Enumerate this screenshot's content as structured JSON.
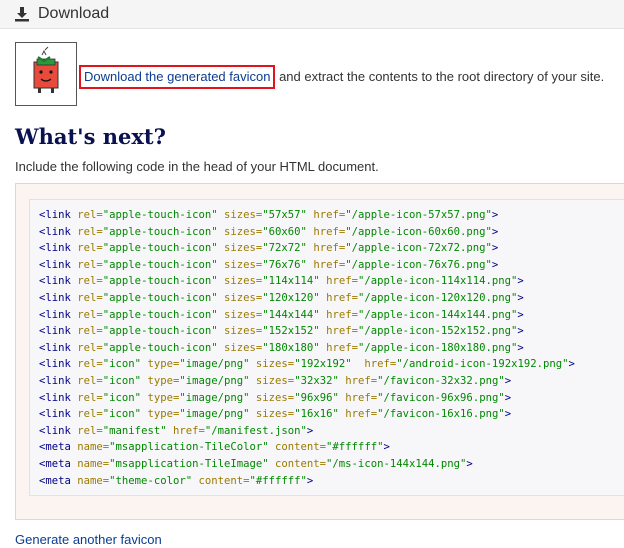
{
  "header": {
    "title": "Download",
    "icon": "download-icon"
  },
  "download": {
    "link_text": "Download the generated favicon",
    "rest_text": " and extract the contents to the root directory of your site."
  },
  "whats_next": {
    "title": "What's next?",
    "include_text": "Include the following code in the head of your HTML document."
  },
  "code_lines": [
    [
      [
        "tag",
        "<link"
      ],
      [
        "p",
        " "
      ],
      [
        "attr",
        "rel="
      ],
      [
        "val",
        "\"apple-touch-icon\""
      ],
      [
        "p",
        " "
      ],
      [
        "attr",
        "sizes="
      ],
      [
        "val",
        "\"57x57\""
      ],
      [
        "p",
        " "
      ],
      [
        "attr",
        "href="
      ],
      [
        "val",
        "\"/apple-icon-57x57.png\""
      ],
      [
        "tag",
        ">"
      ]
    ],
    [
      [
        "tag",
        "<link"
      ],
      [
        "p",
        " "
      ],
      [
        "attr",
        "rel="
      ],
      [
        "val",
        "\"apple-touch-icon\""
      ],
      [
        "p",
        " "
      ],
      [
        "attr",
        "sizes="
      ],
      [
        "val",
        "\"60x60\""
      ],
      [
        "p",
        " "
      ],
      [
        "attr",
        "href="
      ],
      [
        "val",
        "\"/apple-icon-60x60.png\""
      ],
      [
        "tag",
        ">"
      ]
    ],
    [
      [
        "tag",
        "<link"
      ],
      [
        "p",
        " "
      ],
      [
        "attr",
        "rel="
      ],
      [
        "val",
        "\"apple-touch-icon\""
      ],
      [
        "p",
        " "
      ],
      [
        "attr",
        "sizes="
      ],
      [
        "val",
        "\"72x72\""
      ],
      [
        "p",
        " "
      ],
      [
        "attr",
        "href="
      ],
      [
        "val",
        "\"/apple-icon-72x72.png\""
      ],
      [
        "tag",
        ">"
      ]
    ],
    [
      [
        "tag",
        "<link"
      ],
      [
        "p",
        " "
      ],
      [
        "attr",
        "rel="
      ],
      [
        "val",
        "\"apple-touch-icon\""
      ],
      [
        "p",
        " "
      ],
      [
        "attr",
        "sizes="
      ],
      [
        "val",
        "\"76x76\""
      ],
      [
        "p",
        " "
      ],
      [
        "attr",
        "href="
      ],
      [
        "val",
        "\"/apple-icon-76x76.png\""
      ],
      [
        "tag",
        ">"
      ]
    ],
    [
      [
        "tag",
        "<link"
      ],
      [
        "p",
        " "
      ],
      [
        "attr",
        "rel="
      ],
      [
        "val",
        "\"apple-touch-icon\""
      ],
      [
        "p",
        " "
      ],
      [
        "attr",
        "sizes="
      ],
      [
        "val",
        "\"114x114\""
      ],
      [
        "p",
        " "
      ],
      [
        "attr",
        "href="
      ],
      [
        "val",
        "\"/apple-icon-114x114.png\""
      ],
      [
        "tag",
        ">"
      ]
    ],
    [
      [
        "tag",
        "<link"
      ],
      [
        "p",
        " "
      ],
      [
        "attr",
        "rel="
      ],
      [
        "val",
        "\"apple-touch-icon\""
      ],
      [
        "p",
        " "
      ],
      [
        "attr",
        "sizes="
      ],
      [
        "val",
        "\"120x120\""
      ],
      [
        "p",
        " "
      ],
      [
        "attr",
        "href="
      ],
      [
        "val",
        "\"/apple-icon-120x120.png\""
      ],
      [
        "tag",
        ">"
      ]
    ],
    [
      [
        "tag",
        "<link"
      ],
      [
        "p",
        " "
      ],
      [
        "attr",
        "rel="
      ],
      [
        "val",
        "\"apple-touch-icon\""
      ],
      [
        "p",
        " "
      ],
      [
        "attr",
        "sizes="
      ],
      [
        "val",
        "\"144x144\""
      ],
      [
        "p",
        " "
      ],
      [
        "attr",
        "href="
      ],
      [
        "val",
        "\"/apple-icon-144x144.png\""
      ],
      [
        "tag",
        ">"
      ]
    ],
    [
      [
        "tag",
        "<link"
      ],
      [
        "p",
        " "
      ],
      [
        "attr",
        "rel="
      ],
      [
        "val",
        "\"apple-touch-icon\""
      ],
      [
        "p",
        " "
      ],
      [
        "attr",
        "sizes="
      ],
      [
        "val",
        "\"152x152\""
      ],
      [
        "p",
        " "
      ],
      [
        "attr",
        "href="
      ],
      [
        "val",
        "\"/apple-icon-152x152.png\""
      ],
      [
        "tag",
        ">"
      ]
    ],
    [
      [
        "tag",
        "<link"
      ],
      [
        "p",
        " "
      ],
      [
        "attr",
        "rel="
      ],
      [
        "val",
        "\"apple-touch-icon\""
      ],
      [
        "p",
        " "
      ],
      [
        "attr",
        "sizes="
      ],
      [
        "val",
        "\"180x180\""
      ],
      [
        "p",
        " "
      ],
      [
        "attr",
        "href="
      ],
      [
        "val",
        "\"/apple-icon-180x180.png\""
      ],
      [
        "tag",
        ">"
      ]
    ],
    [
      [
        "tag",
        "<link"
      ],
      [
        "p",
        " "
      ],
      [
        "attr",
        "rel="
      ],
      [
        "val",
        "\"icon\""
      ],
      [
        "p",
        " "
      ],
      [
        "attr",
        "type="
      ],
      [
        "val",
        "\"image/png\""
      ],
      [
        "p",
        " "
      ],
      [
        "attr",
        "sizes="
      ],
      [
        "val",
        "\"192x192\""
      ],
      [
        "p",
        "  "
      ],
      [
        "attr",
        "href="
      ],
      [
        "val",
        "\"/android-icon-192x192.png\""
      ],
      [
        "tag",
        ">"
      ]
    ],
    [
      [
        "tag",
        "<link"
      ],
      [
        "p",
        " "
      ],
      [
        "attr",
        "rel="
      ],
      [
        "val",
        "\"icon\""
      ],
      [
        "p",
        " "
      ],
      [
        "attr",
        "type="
      ],
      [
        "val",
        "\"image/png\""
      ],
      [
        "p",
        " "
      ],
      [
        "attr",
        "sizes="
      ],
      [
        "val",
        "\"32x32\""
      ],
      [
        "p",
        " "
      ],
      [
        "attr",
        "href="
      ],
      [
        "val",
        "\"/favicon-32x32.png\""
      ],
      [
        "tag",
        ">"
      ]
    ],
    [
      [
        "tag",
        "<link"
      ],
      [
        "p",
        " "
      ],
      [
        "attr",
        "rel="
      ],
      [
        "val",
        "\"icon\""
      ],
      [
        "p",
        " "
      ],
      [
        "attr",
        "type="
      ],
      [
        "val",
        "\"image/png\""
      ],
      [
        "p",
        " "
      ],
      [
        "attr",
        "sizes="
      ],
      [
        "val",
        "\"96x96\""
      ],
      [
        "p",
        " "
      ],
      [
        "attr",
        "href="
      ],
      [
        "val",
        "\"/favicon-96x96.png\""
      ],
      [
        "tag",
        ">"
      ]
    ],
    [
      [
        "tag",
        "<link"
      ],
      [
        "p",
        " "
      ],
      [
        "attr",
        "rel="
      ],
      [
        "val",
        "\"icon\""
      ],
      [
        "p",
        " "
      ],
      [
        "attr",
        "type="
      ],
      [
        "val",
        "\"image/png\""
      ],
      [
        "p",
        " "
      ],
      [
        "attr",
        "sizes="
      ],
      [
        "val",
        "\"16x16\""
      ],
      [
        "p",
        " "
      ],
      [
        "attr",
        "href="
      ],
      [
        "val",
        "\"/favicon-16x16.png\""
      ],
      [
        "tag",
        ">"
      ]
    ],
    [
      [
        "tag",
        "<link"
      ],
      [
        "p",
        " "
      ],
      [
        "attr",
        "rel="
      ],
      [
        "val",
        "\"manifest\""
      ],
      [
        "p",
        " "
      ],
      [
        "attr",
        "href="
      ],
      [
        "val",
        "\"/manifest.json\""
      ],
      [
        "tag",
        ">"
      ]
    ],
    [
      [
        "tag",
        "<meta"
      ],
      [
        "p",
        " "
      ],
      [
        "attr",
        "name="
      ],
      [
        "val",
        "\"msapplication-TileColor\""
      ],
      [
        "p",
        " "
      ],
      [
        "attr",
        "content="
      ],
      [
        "val",
        "\"#ffffff\""
      ],
      [
        "tag",
        ">"
      ]
    ],
    [
      [
        "tag",
        "<meta"
      ],
      [
        "p",
        " "
      ],
      [
        "attr",
        "name="
      ],
      [
        "val",
        "\"msapplication-TileImage\""
      ],
      [
        "p",
        " "
      ],
      [
        "attr",
        "content="
      ],
      [
        "val",
        "\"/ms-icon-144x144.png\""
      ],
      [
        "tag",
        ">"
      ]
    ],
    [
      [
        "tag",
        "<meta"
      ],
      [
        "p",
        " "
      ],
      [
        "attr",
        "name="
      ],
      [
        "val",
        "\"theme-color\""
      ],
      [
        "p",
        " "
      ],
      [
        "attr",
        "content="
      ],
      [
        "val",
        "\"#ffffff\""
      ],
      [
        "tag",
        ">"
      ]
    ]
  ],
  "footer": {
    "another_link": "Generate another favicon"
  },
  "colors": {
    "highlight": "#e3131b",
    "link": "#0b3d91",
    "heading": "#0a1150"
  }
}
